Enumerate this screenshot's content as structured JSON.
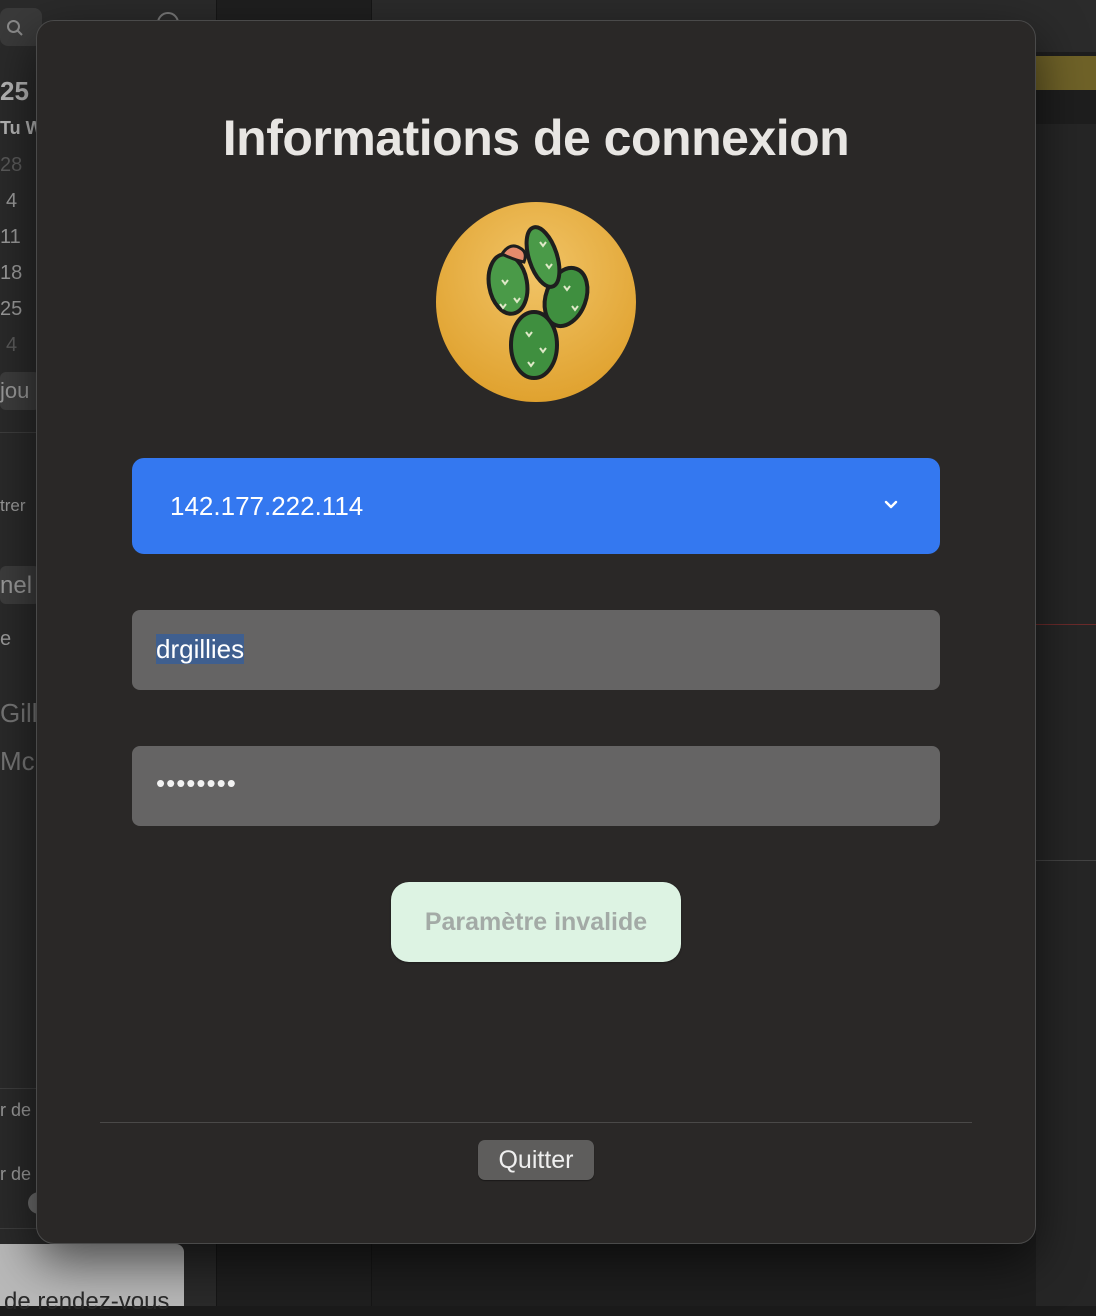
{
  "background_app": {
    "calendar": {
      "month_fragment": "25",
      "weekday_header": "Tu W",
      "days": [
        "28",
        "4",
        "11",
        "18",
        "25",
        "4"
      ]
    },
    "sidebar_fragments": [
      "jou",
      "trer",
      "nel",
      "e",
      "Gilli",
      "Mcl",
      "r de",
      "r de"
    ],
    "bottom_card_text": "de rendez-vous"
  },
  "dialog": {
    "title": "Informations de connexion",
    "logo": "cactus-logo",
    "server": {
      "selected_value": "142.177.222.114",
      "icon": "chevron-down-icon"
    },
    "username": {
      "value": "drgillies"
    },
    "password": {
      "masked_value": "••••••••"
    },
    "submit_label": "Paramètre invalide",
    "quit_label": "Quitter"
  },
  "colors": {
    "accent_blue": "#3478f0",
    "sheet_bg": "#2a2827",
    "field_bg": "#656464",
    "submit_bg": "#ddf3e3",
    "logo_circle": "#e8a93a",
    "cactus_green": "#3f8f3f"
  }
}
